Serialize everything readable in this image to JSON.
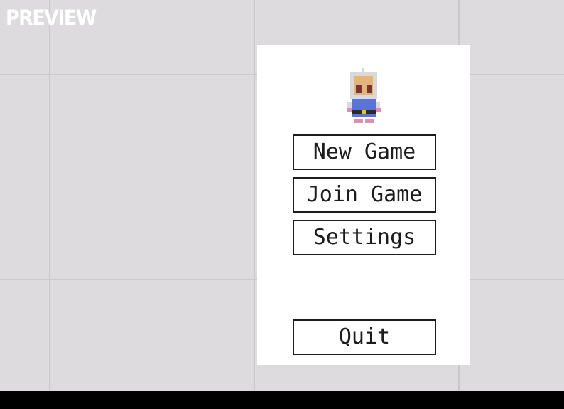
{
  "overlay": {
    "preview_label": "PREVIEW"
  },
  "menu": {
    "buttons": {
      "new_game": "New Game",
      "join_game": "Join Game",
      "settings": "Settings",
      "quit": "Quit"
    }
  },
  "character": {
    "icon": "knight-character-sprite",
    "colors": {
      "helmet": "#d9d9d9",
      "face": "#e2b57d",
      "eyes": "#7a3434",
      "tunic": "#5b72d6",
      "belt": "#2a2a2a",
      "buckle": "#e6c21a",
      "feet": "#d98fb8"
    }
  },
  "colors": {
    "background": "#dddbde",
    "grid": "#cac8cc",
    "panel": "#ffffff",
    "button_border": "#1c1c1c",
    "bottom_bar": "#000000"
  }
}
